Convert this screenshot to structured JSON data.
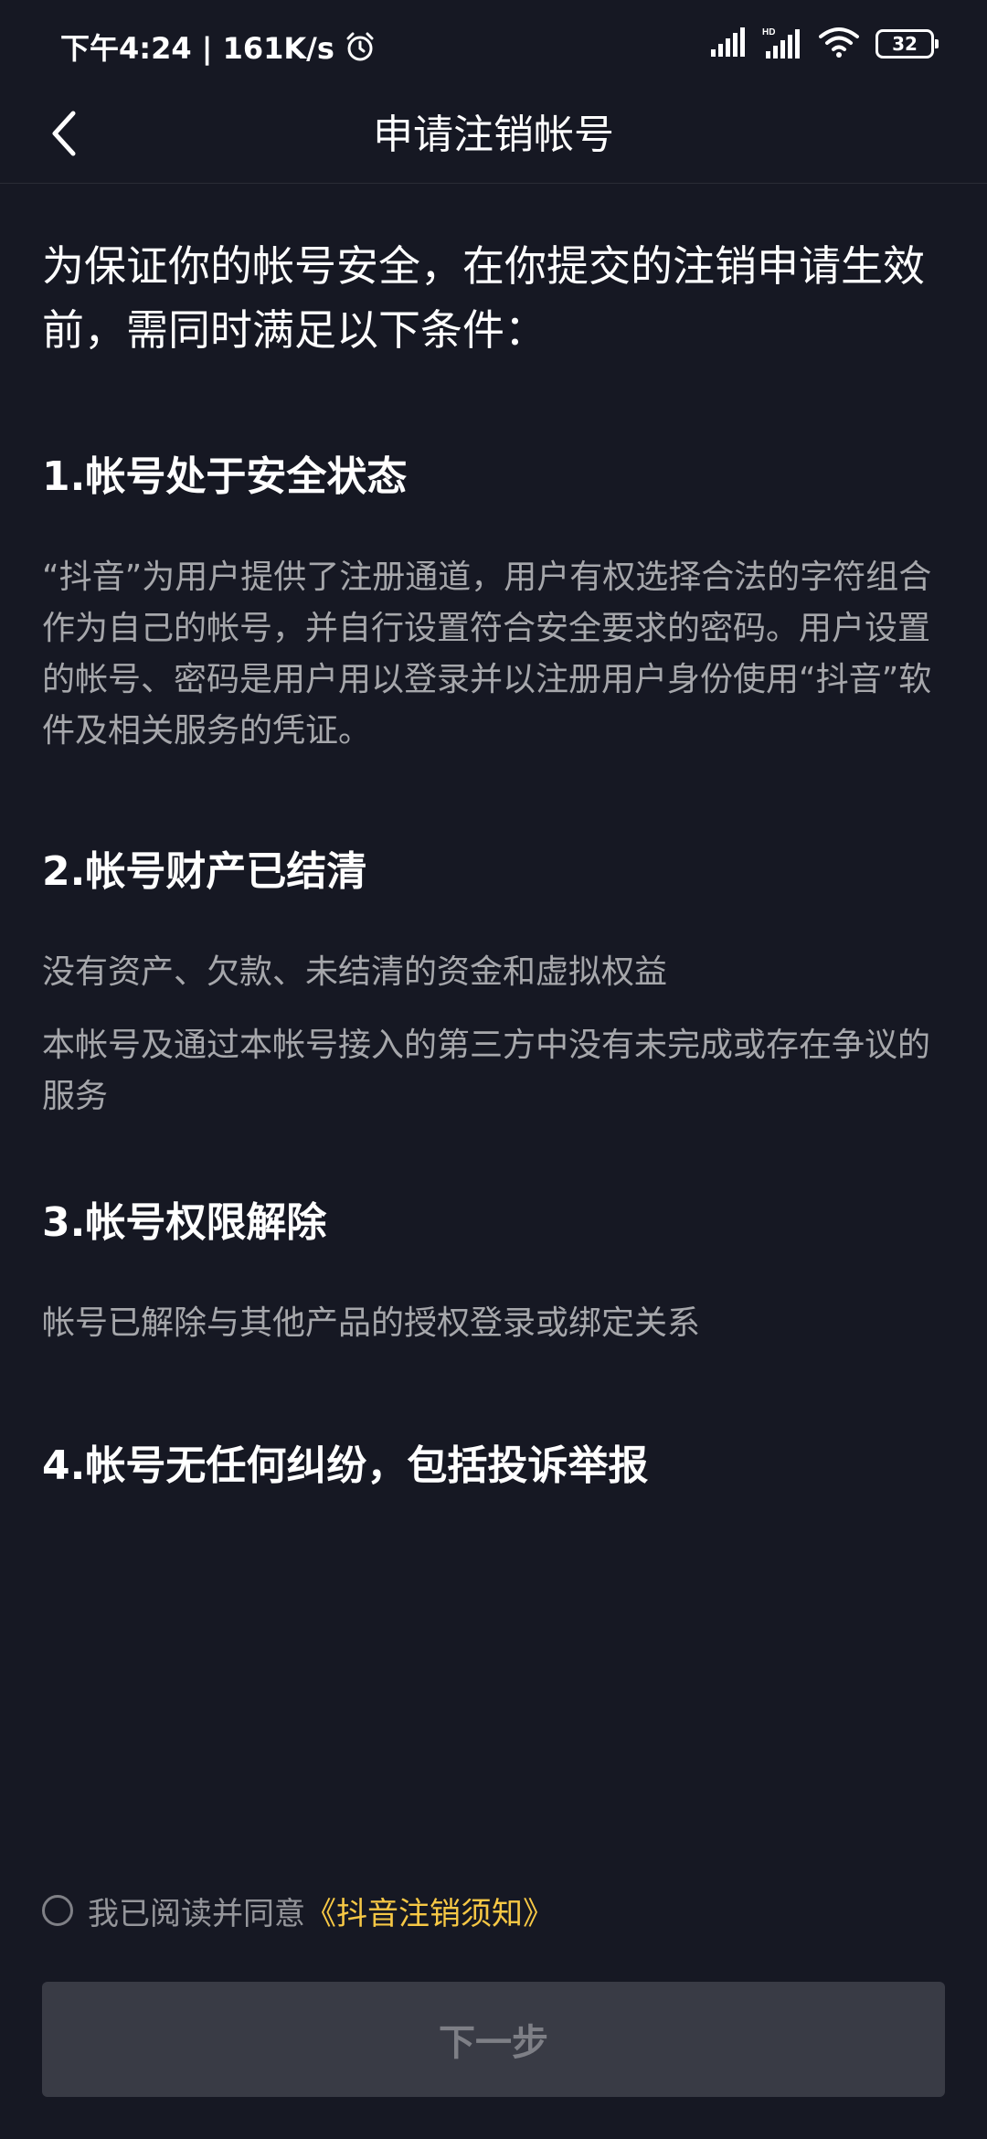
{
  "status_bar": {
    "time_speed": "下午4:24 | 161K/s",
    "icons": [
      "alarm-icon",
      "signal-icon",
      "hd-signal-icon",
      "wifi-icon",
      "battery-icon"
    ],
    "battery_level": "32"
  },
  "header": {
    "title": "申请注销帐号",
    "back_icon": "chevron-left-icon"
  },
  "intro": "为保证你的帐号安全，在你提交的注销申请生效前，需同时满足以下条件：",
  "sections": [
    {
      "title": "1.帐号处于安全状态",
      "paragraphs": [
        "“抖音”为用户提供了注册通道，用户有权选择合法的字符组合作为自己的帐号，并自行设置符合安全要求的密码。用户设置的帐号、密码是用户用以登录并以注册用户身份使用“抖音”软件及相关服务的凭证。"
      ]
    },
    {
      "title": "2.帐号财产已结清",
      "paragraphs": [
        "没有资产、欠款、未结清的资金和虚拟权益",
        "本帐号及通过本帐号接入的第三方中没有未完成或存在争议的服务"
      ]
    },
    {
      "title": "3.帐号权限解除",
      "paragraphs": [
        "帐号已解除与其他产品的授权登录或绑定关系"
      ]
    },
    {
      "title": "4.帐号无任何纠纷，包括投诉举报",
      "paragraphs": []
    }
  ],
  "agreement": {
    "checked": false,
    "text": "我已阅读并同意",
    "link": "《抖音注销须知》"
  },
  "next_button": {
    "label": "下一步",
    "enabled": false
  },
  "colors": {
    "background": "#161823",
    "link": "#f7c845",
    "button_disabled": "#393b45"
  }
}
